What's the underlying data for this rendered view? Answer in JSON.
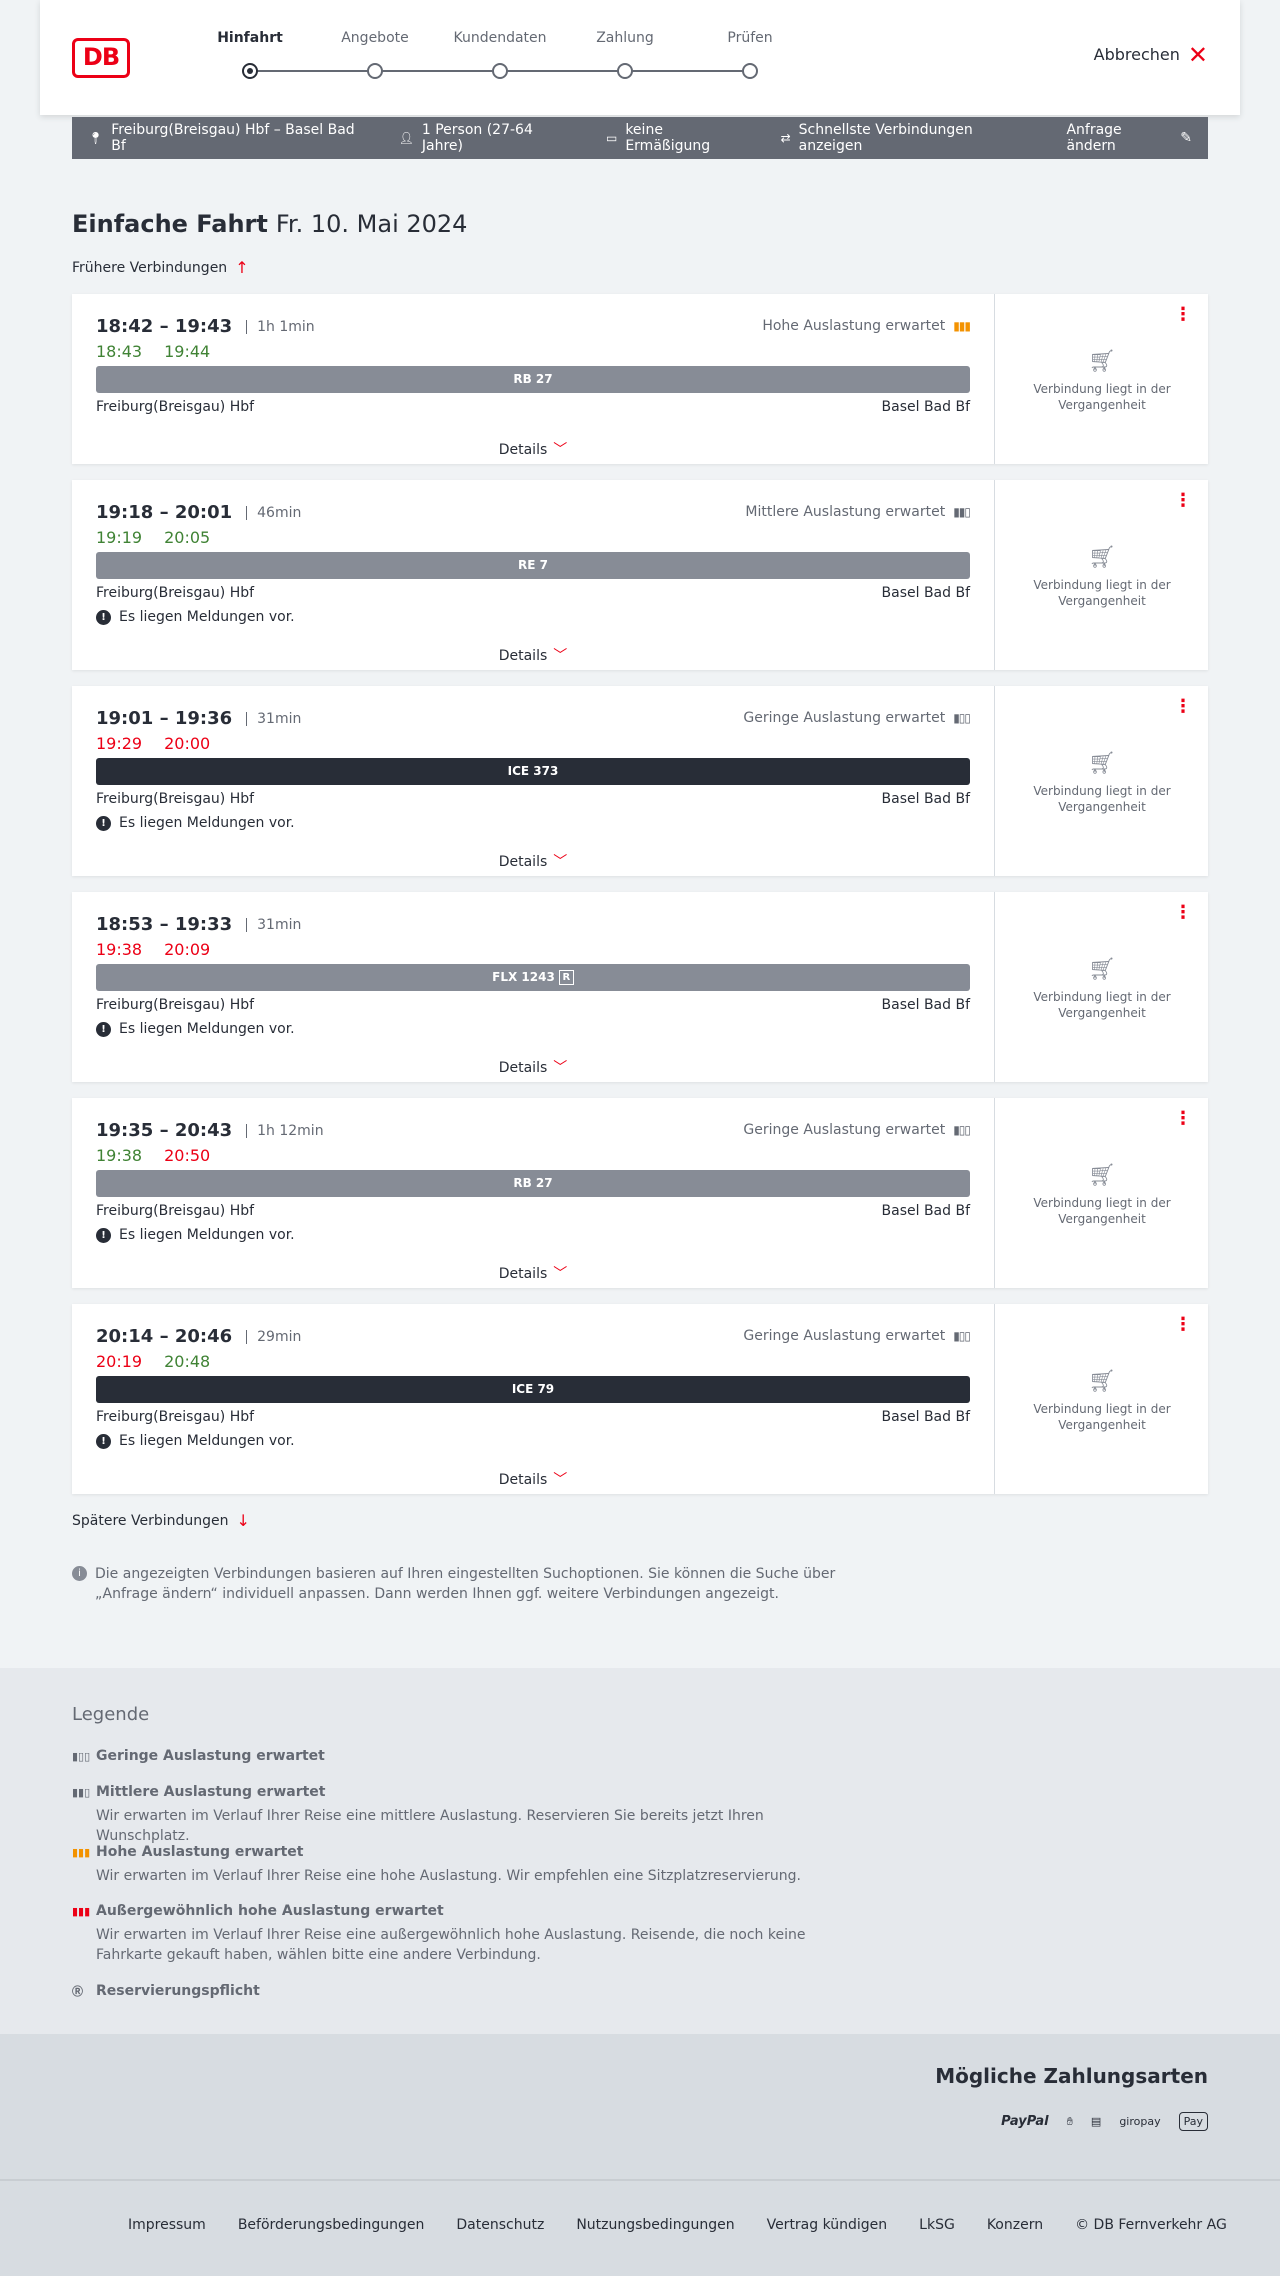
{
  "header": {
    "logo": "DB",
    "steps": [
      "Hinfahrt",
      "Angebote",
      "Kundendaten",
      "Zahlung",
      "Prüfen"
    ],
    "cancel_label": "Abbrechen"
  },
  "searchbar": {
    "route": "Freiburg(Breisgau) Hbf – Basel Bad Bf",
    "persons": "1 Person (27-64 Jahre)",
    "discount": "keine Ermäßigung",
    "fastest": "Schnellste Verbindungen anzeigen",
    "change_label": "Anfrage ändern"
  },
  "title": {
    "main": "Einfache Fahrt",
    "date": "Fr. 10. Mai 2024"
  },
  "earlier_label": "Frühere Verbindungen",
  "later_label": "Spätere Verbindungen",
  "details_label": "Details",
  "past_label": "Verbindung liegt in der Vergangenheit",
  "message_label": "Es liegen Meldungen vor.",
  "connections": [
    {
      "times": "18:42 – 19:43",
      "duration": "1h 1min",
      "rt_dep": "18:43",
      "rt_arr": "19:44",
      "rt_dep_color": "green",
      "rt_arr_color": "green",
      "load": "Hohe Auslastung erwartet",
      "train": "RB 27",
      "from": "Freiburg(Breisgau) Hbf",
      "to": "Basel Bad Bf",
      "message": false
    },
    {
      "times": "19:18 – 20:01",
      "duration": "46min",
      "rt_dep": "19:19",
      "rt_arr": "20:05",
      "rt_dep_color": "green",
      "rt_arr_color": "green",
      "load": "Mittlere Auslastung erwartet",
      "train": "RE 7",
      "from": "Freiburg(Breisgau) Hbf",
      "to": "Basel Bad Bf",
      "message": true
    },
    {
      "times": "19:01 – 19:36",
      "duration": "31min",
      "rt_dep": "19:29",
      "rt_arr": "20:00",
      "rt_dep_color": "red",
      "rt_arr_color": "red",
      "load": "Geringe Auslastung erwartet",
      "train": "ICE 373",
      "from": "Freiburg(Breisgau) Hbf",
      "to": "Basel Bad Bf",
      "message": true
    },
    {
      "times": "18:53 – 19:33",
      "duration": "31min",
      "rt_dep": "19:38",
      "rt_arr": "20:09",
      "rt_dep_color": "red",
      "rt_arr_color": "red",
      "load": "",
      "train": "FLX 1243",
      "from": "Freiburg(Breisgau) Hbf",
      "to": "Basel Bad Bf",
      "message": true
    },
    {
      "times": "19:35 – 20:43",
      "duration": "1h 12min",
      "rt_dep": "19:38",
      "rt_arr": "20:50",
      "rt_dep_color": "green",
      "rt_arr_color": "red",
      "load": "Geringe Auslastung erwartet",
      "train": "RB 27",
      "from": "Freiburg(Breisgau) Hbf",
      "to": "Basel Bad Bf",
      "message": true
    },
    {
      "times": "20:14 – 20:46",
      "duration": "29min",
      "rt_dep": "20:19",
      "rt_arr": "20:48",
      "rt_dep_color": "red",
      "rt_arr_color": "green",
      "load": "Geringe Auslastung erwartet",
      "train": "ICE 79",
      "from": "Freiburg(Breisgau) Hbf",
      "to": "Basel Bad Bf",
      "message": true
    }
  ],
  "info_text": "Die angezeigten Verbindungen basieren auf Ihren eingestellten Suchoptionen. Sie können die Suche über „Anfrage ändern“ individuell anpassen. Dann werden Ihnen ggf. weitere Verbindungen angezeigt.",
  "legend": {
    "title": "Legende",
    "items": [
      {
        "title": "Geringe Auslastung erwartet",
        "desc": ""
      },
      {
        "title": "Mittlere Auslastung erwartet",
        "desc": "Wir erwarten im Verlauf Ihrer Reise eine mittlere Auslastung. Reservieren Sie bereits jetzt Ihren Wunschplatz."
      },
      {
        "title": "Hohe Auslastung erwartet",
        "desc": "Wir erwarten im Verlauf Ihrer Reise eine hohe Auslastung. Wir empfehlen eine Sitzplatzreservierung."
      },
      {
        "title": "Außergewöhnlich hohe Auslastung erwartet",
        "desc": "Wir erwarten im Verlauf Ihrer Reise eine außergewöhnlich hohe Auslastung. Reisende, die noch keine Fahrkarte gekauft haben, wählen bitte eine andere Verbindung."
      },
      {
        "title": "Reservierungspflicht",
        "desc": ""
      }
    ]
  },
  "payment": {
    "title": "Mögliche Zahlungsarten",
    "methods": [
      "PayPal",
      "giropay",
      "Pay"
    ]
  },
  "footer": {
    "links": [
      "Impressum",
      "Beförderungsbedingungen",
      "Datenschutz",
      "Nutzungsbedingungen",
      "Vertrag kündigen",
      "LkSG",
      "Konzern",
      "© DB Fernverkehr AG"
    ]
  },
  "colors": {
    "accent": "#ec0016",
    "green": "#408335",
    "dark": "#282d37",
    "gray": "#646973"
  }
}
